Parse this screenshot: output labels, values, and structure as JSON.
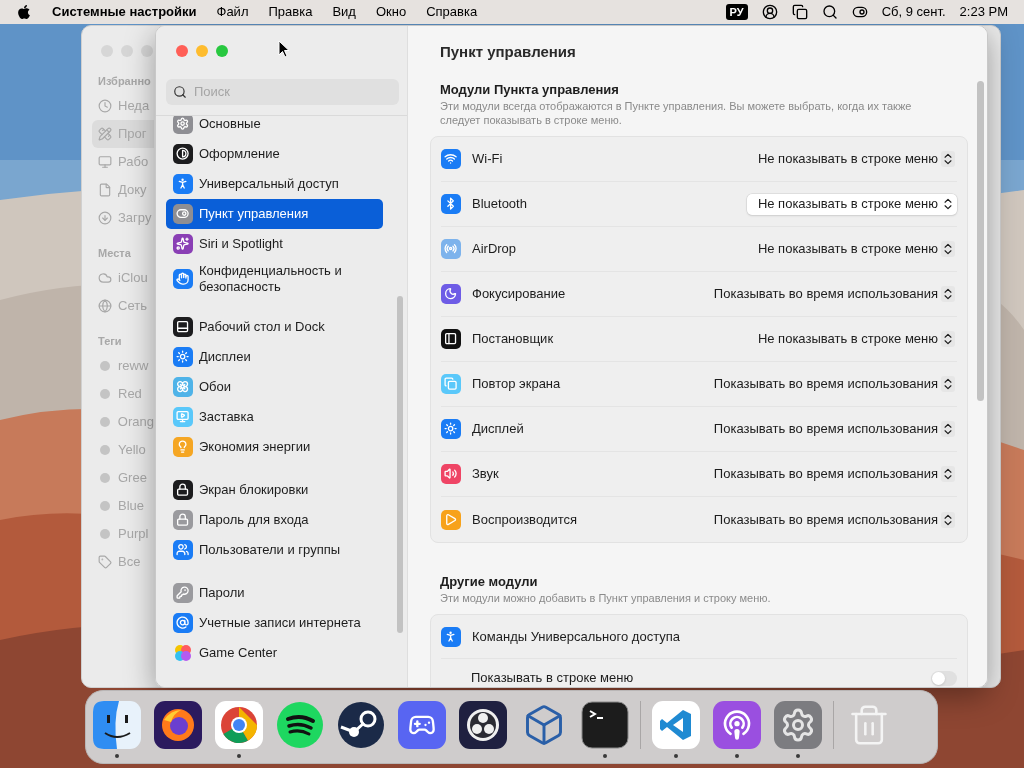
{
  "menu_bar": {
    "app_name": "Системные настройки",
    "menus": [
      "Файл",
      "Правка",
      "Вид",
      "Окно",
      "Справка"
    ],
    "input_source": "РУ",
    "date": "Сб, 9 сент.",
    "time": "2:23 PM"
  },
  "finder": {
    "sections": [
      {
        "title": "Избранно",
        "items": [
          {
            "label": "Неда",
            "selected": false
          },
          {
            "label": "Прог",
            "selected": true
          },
          {
            "label": "Рабо",
            "selected": false
          },
          {
            "label": "Доку",
            "selected": false
          },
          {
            "label": "Загру",
            "selected": false
          }
        ]
      },
      {
        "title": "Места",
        "items": [
          {
            "label": "iClou",
            "selected": false
          },
          {
            "label": "Сеть",
            "selected": false
          }
        ]
      },
      {
        "title": "Теги",
        "items": [
          {
            "label": "reww",
            "selected": false
          },
          {
            "label": "Red",
            "selected": false
          },
          {
            "label": "Orang",
            "selected": false
          },
          {
            "label": "Yello",
            "selected": false
          },
          {
            "label": "Gree",
            "selected": false
          },
          {
            "label": "Blue",
            "selected": false
          },
          {
            "label": "Purpl",
            "selected": false
          },
          {
            "label": "Все",
            "selected": false
          }
        ]
      }
    ]
  },
  "settings": {
    "search_placeholder": "Поиск",
    "title": "Пункт управления",
    "sidebar_groups": [
      [
        {
          "label": "Основные",
          "selected": false
        },
        {
          "label": "Оформление",
          "selected": false
        },
        {
          "label": "Универсальный доступ",
          "selected": false
        },
        {
          "label": "Пункт управления",
          "selected": true
        },
        {
          "label": "Siri и Spotlight",
          "selected": false
        },
        {
          "label": "Конфиденциальность и безопасность",
          "selected": false
        }
      ],
      [
        {
          "label": "Рабочий стол и Dock",
          "selected": false
        },
        {
          "label": "Дисплеи",
          "selected": false
        },
        {
          "label": "Обои",
          "selected": false
        },
        {
          "label": "Заставка",
          "selected": false
        },
        {
          "label": "Экономия энергии",
          "selected": false
        }
      ],
      [
        {
          "label": "Экран блокировки",
          "selected": false
        },
        {
          "label": "Пароль для входа",
          "selected": false
        },
        {
          "label": "Пользователи и группы",
          "selected": false
        }
      ],
      [
        {
          "label": "Пароли",
          "selected": false
        },
        {
          "label": "Учетные записи интернета",
          "selected": false
        },
        {
          "label": "Game Center",
          "selected": false
        }
      ]
    ],
    "sections": [
      {
        "heading": "Модули Пункта управления",
        "description": "Эти модули всегда отображаются в Пункте управления. Вы можете выбрать, когда их также следует показывать в строке меню.",
        "rows": [
          {
            "kind": "select",
            "label": "Wi-Fi",
            "value": "Не показывать в строке меню",
            "highlighted": false
          },
          {
            "kind": "select",
            "label": "Bluetooth",
            "value": "Не показывать в строке меню",
            "highlighted": true
          },
          {
            "kind": "select",
            "label": "AirDrop",
            "value": "Не показывать в строке меню",
            "highlighted": false
          },
          {
            "kind": "select",
            "label": "Фокусирование",
            "value": "Показывать во время использования",
            "highlighted": false
          },
          {
            "kind": "select",
            "label": "Постановщик",
            "value": "Не показывать в строке меню",
            "highlighted": false
          },
          {
            "kind": "select",
            "label": "Повтор экрана",
            "value": "Показывать во время использования",
            "highlighted": false
          },
          {
            "kind": "select",
            "label": "Дисплей",
            "value": "Показывать во время использования",
            "highlighted": false
          },
          {
            "kind": "select",
            "label": "Звук",
            "value": "Показывать во время использования",
            "highlighted": false
          },
          {
            "kind": "select",
            "label": "Воспроизводится",
            "value": "Показывать во время использования",
            "highlighted": false
          }
        ]
      },
      {
        "heading": "Другие модули",
        "description": "Эти модули можно добавить в Пункт управления и строку меню.",
        "rows": [
          {
            "kind": "toggle",
            "label": "Команды Универсального доступа",
            "option": "Показывать в строке меню",
            "on": false
          }
        ]
      }
    ]
  },
  "dock": {
    "groups": [
      [
        {
          "running": true
        },
        {
          "running": false
        },
        {
          "running": true
        },
        {
          "running": false
        },
        {
          "running": false
        },
        {
          "running": false
        },
        {
          "running": false
        },
        {
          "running": false
        },
        {
          "running": true
        }
      ],
      [
        {
          "running": true
        },
        {
          "running": true
        },
        {
          "running": true
        }
      ],
      [
        {
          "running": false
        }
      ]
    ]
  }
}
